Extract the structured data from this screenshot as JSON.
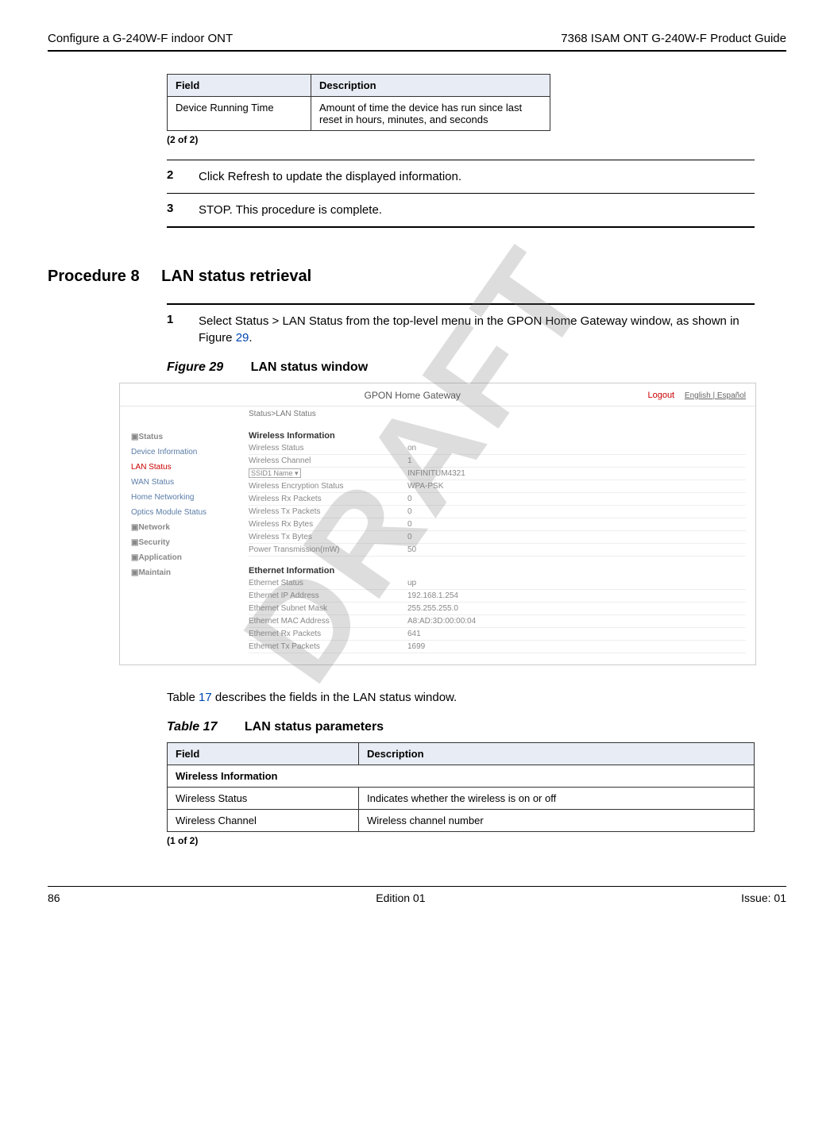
{
  "header": {
    "left": "Configure a G-240W-F indoor ONT",
    "right": "7368 ISAM ONT G-240W-F Product Guide"
  },
  "watermark": "DRAFT",
  "table_top": {
    "headers": [
      "Field",
      "Description"
    ],
    "row": {
      "field": "Device Running Time",
      "desc": "Amount of time the device has run since last reset in hours, minutes, and seconds"
    },
    "caption": "(2 of 2)"
  },
  "steps_upper": [
    {
      "num": "2",
      "text": "Click Refresh to update the displayed information."
    },
    {
      "num": "3",
      "text": "STOP. This procedure is complete."
    }
  ],
  "procedure": {
    "label": "Procedure 8",
    "title": "LAN status retrieval"
  },
  "step1": {
    "num": "1",
    "text_prefix": "Select Status > LAN Status from the top-level menu in the GPON Home Gateway window, as shown in Figure ",
    "fig_ref": "29",
    "text_suffix": "."
  },
  "figure": {
    "label": "Figure 29",
    "title": "LAN status window",
    "screenshot": {
      "app_title": "GPON Home Gateway",
      "logout": "Logout",
      "lang": "English | Español",
      "breadcrumb": "Status>LAN Status",
      "sidebar": {
        "section_status": "Status",
        "items": [
          "Device Information",
          "LAN Status",
          "WAN Status",
          "Home Networking",
          "Optics Module Status"
        ],
        "collapsed": [
          "Network",
          "Security",
          "Application",
          "Maintain"
        ]
      },
      "wireless_title": "Wireless Information",
      "wireless": [
        {
          "k": "Wireless Status",
          "v": "on"
        },
        {
          "k": "Wireless Channel",
          "v": "1"
        },
        {
          "k": "SSID1 Name ▾",
          "v": "INFINITUM4321",
          "select": true
        },
        {
          "k": "Wireless Encryption Status",
          "v": "WPA-PSK"
        },
        {
          "k": "Wireless Rx Packets",
          "v": "0"
        },
        {
          "k": "Wireless Tx Packets",
          "v": "0"
        },
        {
          "k": "Wireless Rx Bytes",
          "v": "0"
        },
        {
          "k": "Wireless Tx Bytes",
          "v": "0"
        },
        {
          "k": "Power Transmission(mW)",
          "v": "50"
        }
      ],
      "ethernet_title": "Ethernet Information",
      "ethernet": [
        {
          "k": "Ethernet Status",
          "v": "up"
        },
        {
          "k": "Ethernet IP Address",
          "v": "192.168.1.254"
        },
        {
          "k": "Ethernet Subnet Mask",
          "v": "255.255.255.0"
        },
        {
          "k": "Ethernet MAC Address",
          "v": "A8:AD:3D:00:00:04"
        },
        {
          "k": "Ethernet Rx Packets",
          "v": "641"
        },
        {
          "k": "Ethernet Tx Packets",
          "v": "1699"
        }
      ]
    }
  },
  "para_after_fig": {
    "prefix": "Table ",
    "ref": "17",
    "suffix": " describes the fields in the LAN status window."
  },
  "table17": {
    "label": "Table 17",
    "title": "LAN status parameters",
    "headers": [
      "Field",
      "Description"
    ],
    "section": "Wireless Information",
    "rows": [
      {
        "f": "Wireless Status",
        "d": "Indicates whether the wireless is on or off"
      },
      {
        "f": "Wireless Channel",
        "d": "Wireless channel number"
      }
    ],
    "caption": "(1 of 2)"
  },
  "footer": {
    "left": "86",
    "center": "Edition 01",
    "right": "Issue: 01"
  }
}
